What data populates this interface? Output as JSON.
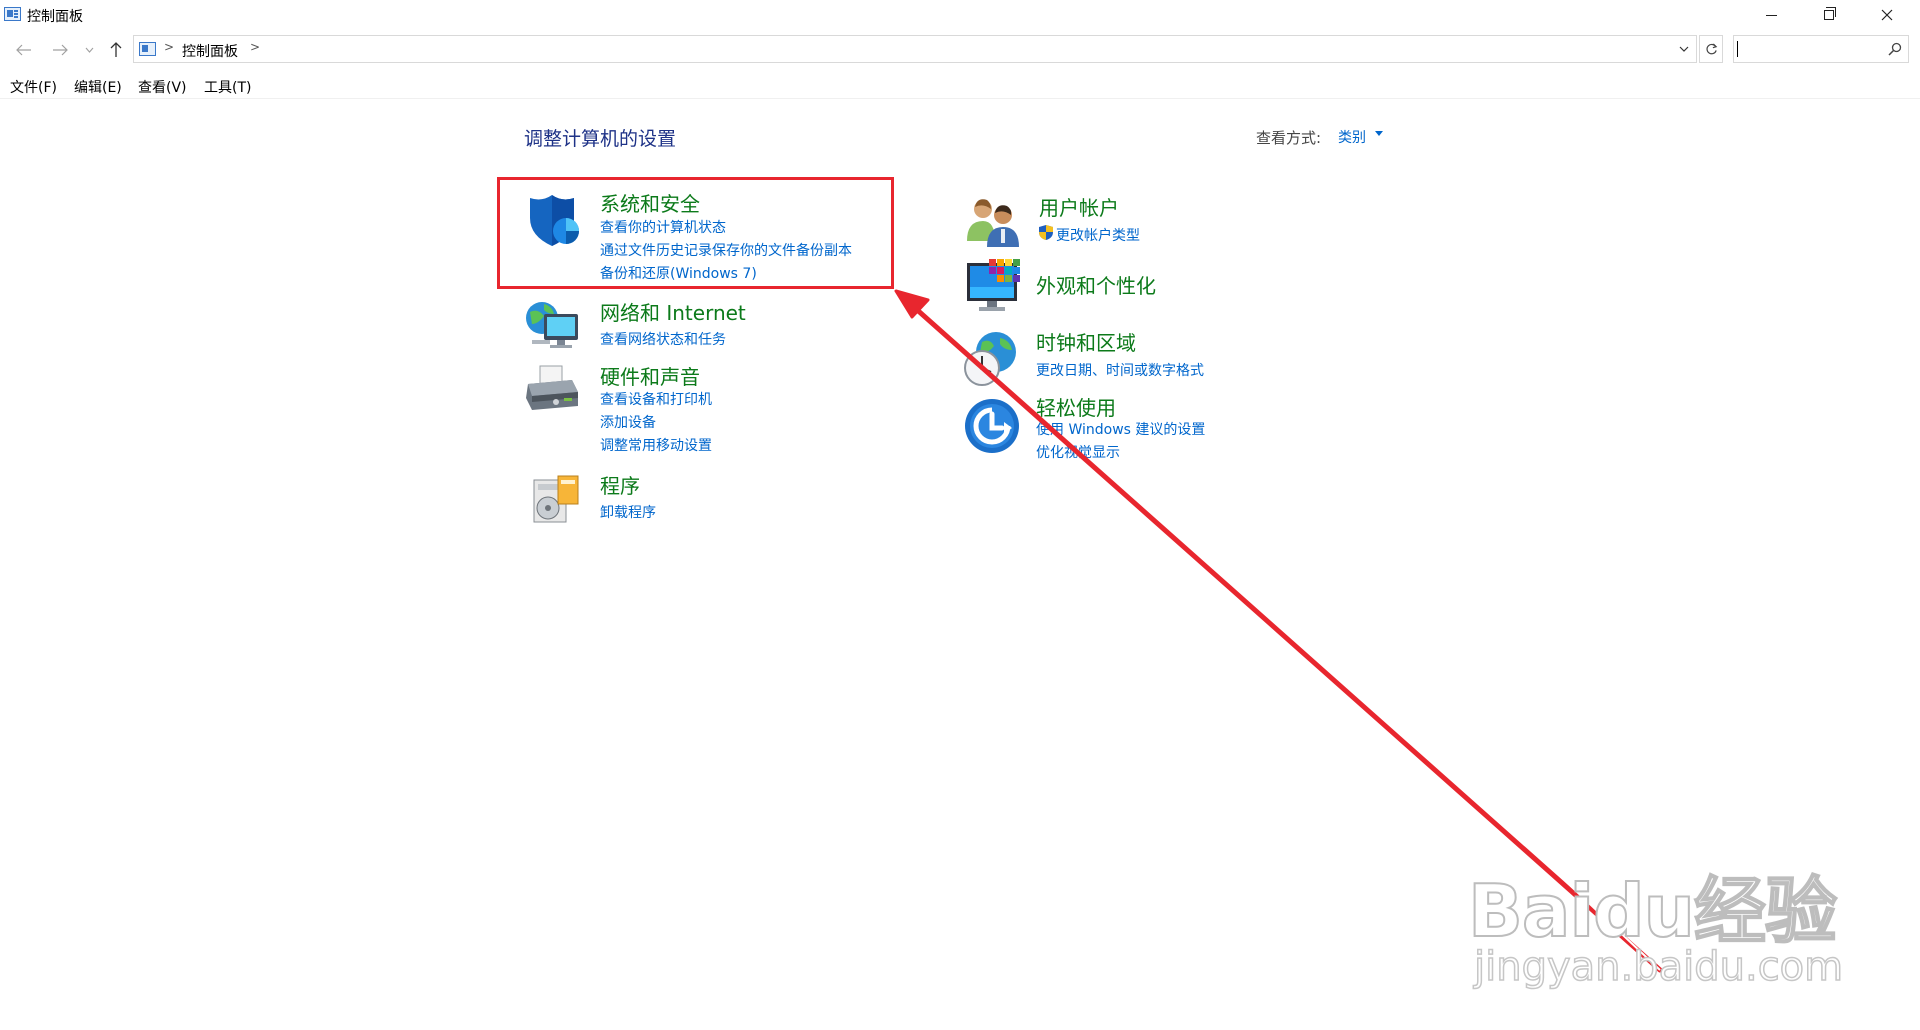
{
  "window": {
    "title": "控制面板"
  },
  "address_bar": {
    "crumb": "控制面板",
    "separator": ">"
  },
  "menu": {
    "items": [
      "文件(F)",
      "编辑(E)",
      "查看(V)",
      "工具(T)"
    ]
  },
  "main": {
    "title": "调整计算机的设置",
    "view_by_label": "查看方式:",
    "view_by_value": "类别"
  },
  "categories_left": [
    {
      "title": "系统和安全",
      "icon": "shield-icon",
      "links": [
        "查看你的计算机状态",
        "通过文件历史记录保存你的文件备份副本",
        "备份和还原(Windows 7)"
      ]
    },
    {
      "title": "网络和 Internet",
      "icon": "network-icon",
      "links": [
        "查看网络状态和任务"
      ]
    },
    {
      "title": "硬件和声音",
      "icon": "printer-icon",
      "links": [
        "查看设备和打印机",
        "添加设备",
        "调整常用移动设置"
      ]
    },
    {
      "title": "程序",
      "icon": "programs-icon",
      "links": [
        "卸载程序"
      ]
    }
  ],
  "categories_right": [
    {
      "title": "用户帐户",
      "icon": "users-icon",
      "links": [
        "更改帐户类型"
      ]
    },
    {
      "title": "外观和个性化",
      "icon": "monitor-palette-icon",
      "links": []
    },
    {
      "title": "时钟和区域",
      "icon": "clock-globe-icon",
      "links": [
        "更改日期、时间或数字格式"
      ]
    },
    {
      "title": "轻松使用",
      "icon": "accessibility-icon",
      "links": [
        "使用 Windows 建议的设置",
        "优化视觉显示"
      ]
    }
  ],
  "watermark": {
    "logo_text": "Baidu经验",
    "url": "jingyan.baidu.com"
  },
  "colors": {
    "category_title": "#0c7a1a",
    "link": "#0066cc",
    "page_title": "#1e3287",
    "annotation": "#e8262e"
  }
}
